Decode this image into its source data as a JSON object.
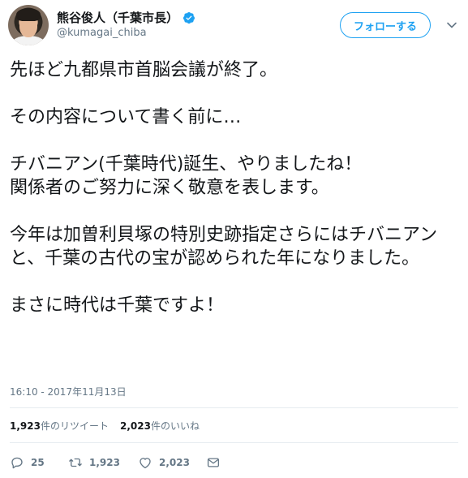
{
  "user": {
    "display_name": "熊谷俊人（千葉市長）",
    "handle": "@kumagai_chiba",
    "verified": true
  },
  "follow_button": {
    "label": "フォローする"
  },
  "tweet": {
    "paragraphs": [
      "先ほど九都県市首脳会議が終了。",
      "その内容について書く前に…",
      "チバニアン(千葉時代)誕生、やりましたね！\n関係者のご努力に深く敬意を表します。",
      "今年は加曽利貝塚の特別史跡指定さらにはチバニアンと、千葉の古代の宝が認められた年になりました。",
      "まさに時代は千葉ですよ！"
    ],
    "timestamp": "16:10 - 2017年11月13日"
  },
  "stats": {
    "retweets_count": "1,923",
    "retweets_label": "件のリツイート",
    "likes_count": "2,023",
    "likes_label": "件のいいね"
  },
  "actions": {
    "reply_count": "25",
    "retweet_count": "1,923",
    "like_count": "2,023"
  },
  "colors": {
    "accent": "#1da1f2",
    "text": "#14171a",
    "muted": "#657786",
    "divider": "#e6ecf0"
  },
  "icons": [
    "verified-icon",
    "chevron-down-icon",
    "reply-icon",
    "retweet-icon",
    "like-icon",
    "message-icon"
  ]
}
